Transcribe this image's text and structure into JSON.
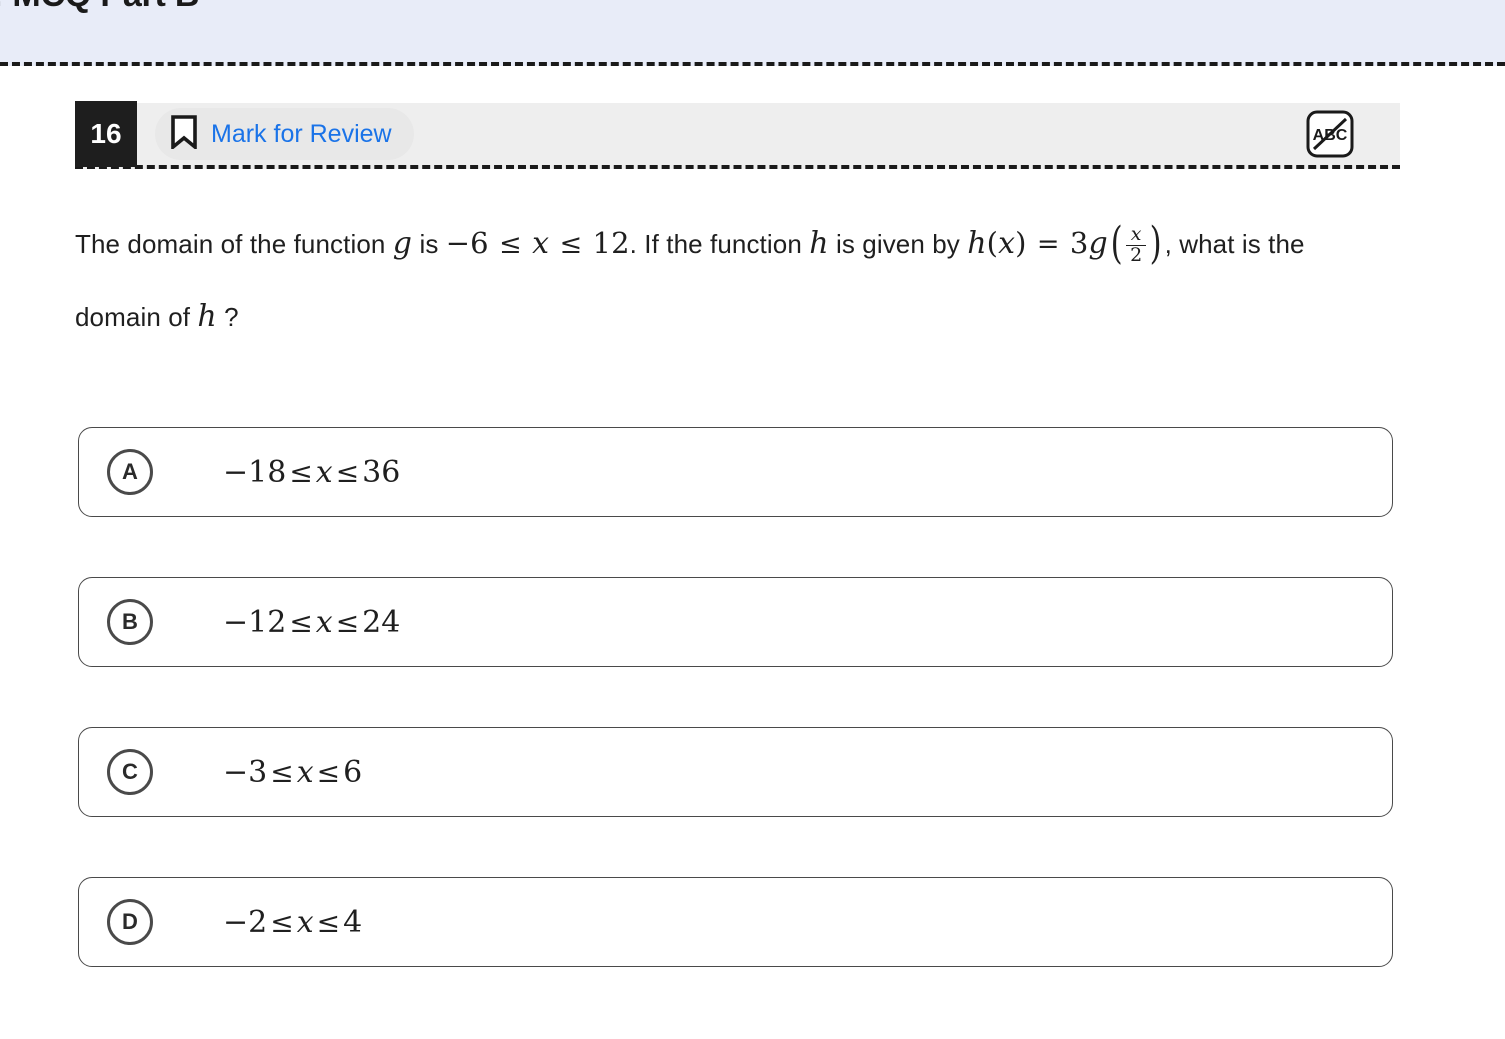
{
  "section": {
    "title": ": MCQ Part B",
    "background_color": "#e8ecf8"
  },
  "question": {
    "number": "16",
    "mark_for_review_label": "Mark for Review",
    "mark_for_review_color": "#1a73e8",
    "bookmark_icon": "bookmark-icon",
    "abc_tool_icon": "abc-strikethrough-icon",
    "abc_tool_text": "ABC",
    "stem": {
      "part1": "The domain of the function",
      "var_g": "g",
      "part2": "is",
      "range_low": "−6",
      "le1": "≤",
      "var_x1": "x",
      "le2": "≤",
      "range_high": "12",
      "part3": ". If the function",
      "var_h1": "h",
      "part4": "is given by",
      "func_h": "h",
      "open_paren1": "(",
      "var_x2": "x",
      "close_paren1": ")",
      "equals": "=",
      "coef3": "3",
      "func_g": "g",
      "frac_num": "x",
      "frac_den": "2",
      "part5": ", what is the",
      "part6": "domain of",
      "var_h2": "h",
      "question_mark": "?"
    }
  },
  "choices": [
    {
      "letter": "A",
      "low": "−18",
      "le1": "≤",
      "var": "x",
      "le2": "≤",
      "high": "36"
    },
    {
      "letter": "B",
      "low": "−12",
      "le1": "≤",
      "var": "x",
      "le2": "≤",
      "high": "24"
    },
    {
      "letter": "C",
      "low": "−3",
      "le1": "≤",
      "var": "x",
      "le2": "≤",
      "high": "6"
    },
    {
      "letter": "D",
      "low": "−2",
      "le1": "≤",
      "var": "x",
      "le2": "≤",
      "high": "4"
    }
  ]
}
